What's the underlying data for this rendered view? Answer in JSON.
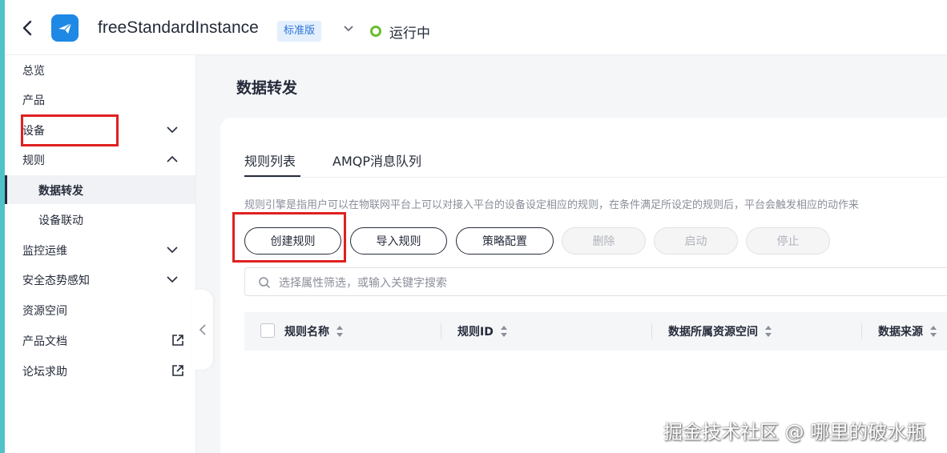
{
  "header": {
    "instance_name": "freeStandardInstance",
    "edition": "标准版",
    "status": "运行中",
    "status_color": "#6bbd2c"
  },
  "sidebar": {
    "items": [
      {
        "label": "总览"
      },
      {
        "label": "产品"
      },
      {
        "label": "设备",
        "icon": "chevron-down-icon"
      },
      {
        "label": "规则",
        "icon": "chevron-up-icon"
      },
      {
        "label": "数据转发",
        "active": true
      },
      {
        "label": "设备联动"
      },
      {
        "label": "监控运维",
        "icon": "chevron-down-icon"
      },
      {
        "label": "安全态势感知",
        "icon": "chevron-down-icon"
      },
      {
        "label": "资源空间"
      },
      {
        "label": "产品文档",
        "icon": "external-link-icon"
      },
      {
        "label": "论坛求助",
        "icon": "external-link-icon"
      }
    ]
  },
  "main": {
    "title": "数据转发",
    "tabs": [
      {
        "label": "规则列表",
        "active": true
      },
      {
        "label": "AMQP消息队列"
      }
    ],
    "description": "规则引擎是指用户可以在物联网平台上可以对接入平台的设备设定相应的规则，在条件满足所设定的规则后，平台会触发相应的动作来",
    "buttons": [
      {
        "label": "创建规则",
        "enabled": true
      },
      {
        "label": "导入规则",
        "enabled": true
      },
      {
        "label": "策略配置",
        "enabled": true
      },
      {
        "label": "删除",
        "enabled": false
      },
      {
        "label": "启动",
        "enabled": false
      },
      {
        "label": "停止",
        "enabled": false
      }
    ],
    "search_placeholder": "选择属性筛选，或输入关键字搜索",
    "table_columns": [
      "规则名称",
      "规则ID",
      "数据所属资源空间",
      "数据来源"
    ]
  },
  "watermark": "掘金技术社区 @ 哪里的破水瓶"
}
